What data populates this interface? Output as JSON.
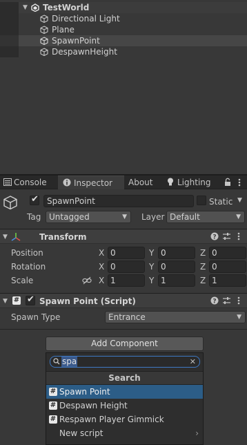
{
  "hierarchy": {
    "scene_name": "TestWorld",
    "items": [
      {
        "label": "Directional Light"
      },
      {
        "label": "Plane"
      },
      {
        "label": "SpawnPoint"
      },
      {
        "label": "DespawnHeight"
      }
    ]
  },
  "tabs": {
    "console": "Console",
    "inspector": "Inspector",
    "about": "About",
    "lighting": "Lighting"
  },
  "object": {
    "name": "SpawnPoint",
    "active": true,
    "static_label": "Static",
    "tag_label": "Tag",
    "tag_value": "Untagged",
    "layer_label": "Layer",
    "layer_value": "Default"
  },
  "transform": {
    "title": "Transform",
    "position_label": "Position",
    "rotation_label": "Rotation",
    "scale_label": "Scale",
    "axis_x": "X",
    "axis_y": "Y",
    "axis_z": "Z",
    "position": {
      "x": "0",
      "y": "0",
      "z": "0"
    },
    "rotation": {
      "x": "0",
      "y": "0",
      "z": "0"
    },
    "scale": {
      "x": "1",
      "y": "1",
      "z": "1"
    }
  },
  "script_component": {
    "title": "Spawn Point (Script)",
    "enabled": true,
    "field_label": "Spawn Type",
    "field_value": "Entrance"
  },
  "add_component": {
    "button_label": "Add Component",
    "search_query": "spa",
    "section_title": "Search",
    "results": [
      {
        "label": "Spawn Point"
      },
      {
        "label": "Despawn Height"
      },
      {
        "label": "Respawn Player Gimmick"
      }
    ],
    "new_script_label": "New script"
  },
  "colors": {
    "panel_bg": "#383838",
    "selection_blue": "#2c5d87",
    "search_focus": "#3e79c4"
  }
}
